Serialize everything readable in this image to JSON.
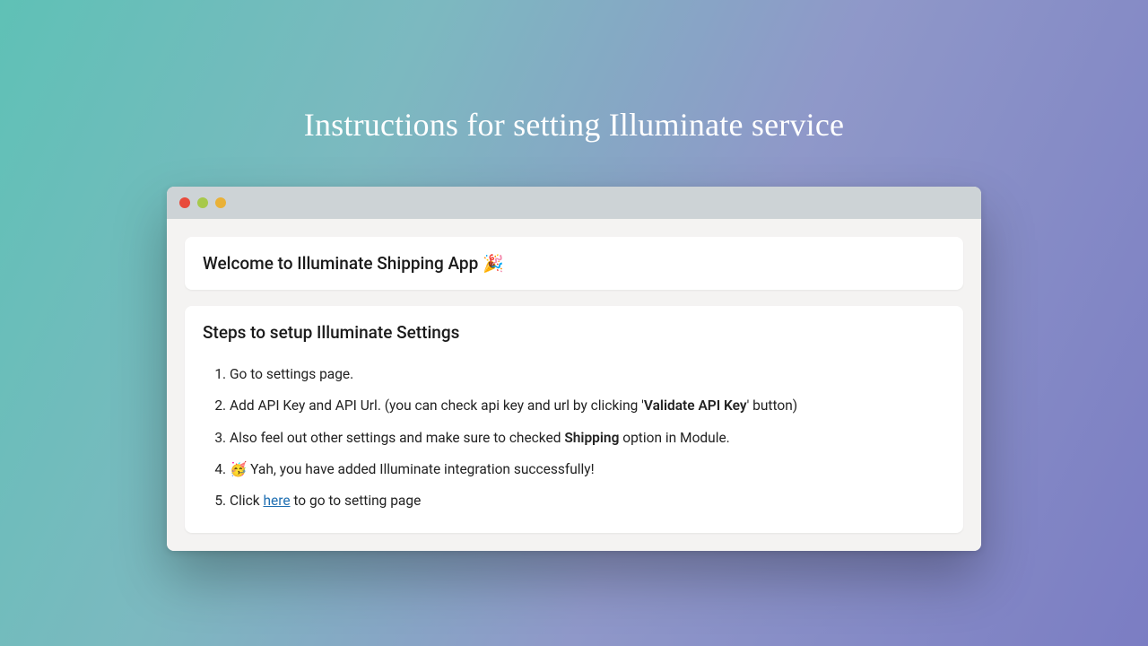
{
  "page_title": "Instructions for setting Illuminate service",
  "welcome_card": {
    "title": "Welcome to Illuminate Shipping App 🎉"
  },
  "steps_card": {
    "title": "Steps to setup Illuminate Settings",
    "step1": "Go to settings page.",
    "step2_pre": "Add API Key and API Url. (you can check api key and url by clicking '",
    "step2_bold": "Validate API Key",
    "step2_post": "' button)",
    "step3_pre": "Also feel out other settings and make sure to checked ",
    "step3_bold": "Shipping",
    "step3_post": " option in Module.",
    "step4": "🥳 Yah, you have added Illuminate integration successfully!",
    "step5_pre": "Click ",
    "step5_link": "here",
    "step5_post": " to go to setting page"
  }
}
